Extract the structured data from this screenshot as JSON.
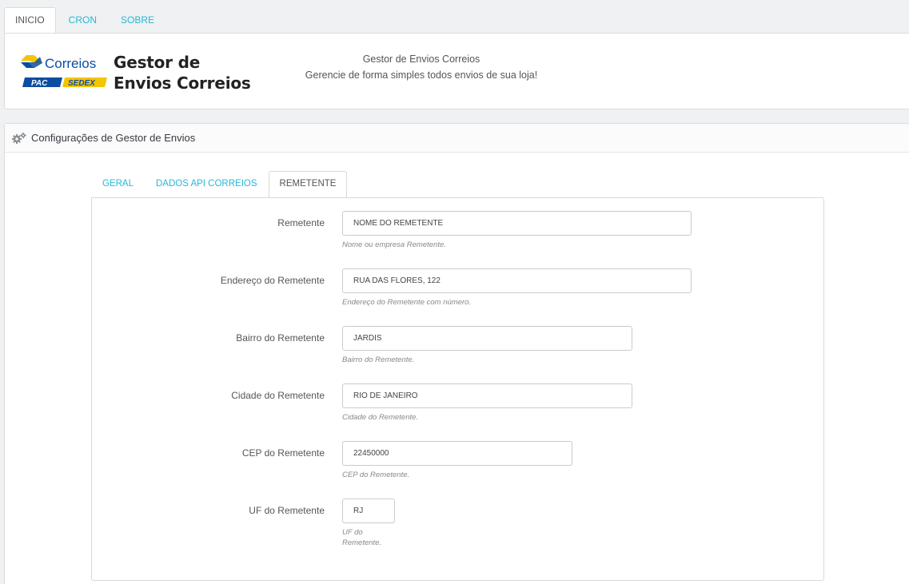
{
  "top_tabs": [
    {
      "label": "INICIO",
      "active": true
    },
    {
      "label": "CRON",
      "active": false
    },
    {
      "label": "SOBRE",
      "active": false
    }
  ],
  "header": {
    "logo": {
      "brand": "Correios",
      "pac": "PAC",
      "sedex": "SEDEX"
    },
    "title_line1": "Gestor de",
    "title_line2": "Envios Correios",
    "desc_line1": "Gestor de Envios Correios",
    "desc_line2": "Gerencie de forma simples todos envios de sua loja!"
  },
  "config": {
    "title": "Configurações de Gestor de Envios",
    "tabs": [
      {
        "label": "GERAL",
        "active": false
      },
      {
        "label": "DADOS API CORREIOS",
        "active": false
      },
      {
        "label": "REMETENTE",
        "active": true
      }
    ],
    "fields": [
      {
        "label": "Remetente",
        "value": "NOME DO REMETENTE",
        "help": "Nome ou empresa Remetente."
      },
      {
        "label": "Endereço do Remetente",
        "value": "RUA DAS FLORES, 122",
        "help": "Endereço do Remetente com número."
      },
      {
        "label": "Bairro do Remetente",
        "value": "JARDIS",
        "help": "Bairro do Remetente."
      },
      {
        "label": "Cidade do Remetente",
        "value": "RIO DE JANEIRO",
        "help": "Cidade do Remetente."
      },
      {
        "label": "CEP do Remetente",
        "value": "22450000",
        "help": "CEP do Remetente."
      },
      {
        "label": "UF do Remetente",
        "value": "RJ",
        "help_line1": "UF do",
        "help_line2": "Remetente."
      }
    ]
  },
  "colors": {
    "link": "#25b9d7",
    "correios_yellow": "#f5c400",
    "correios_blue": "#0b4da2"
  }
}
